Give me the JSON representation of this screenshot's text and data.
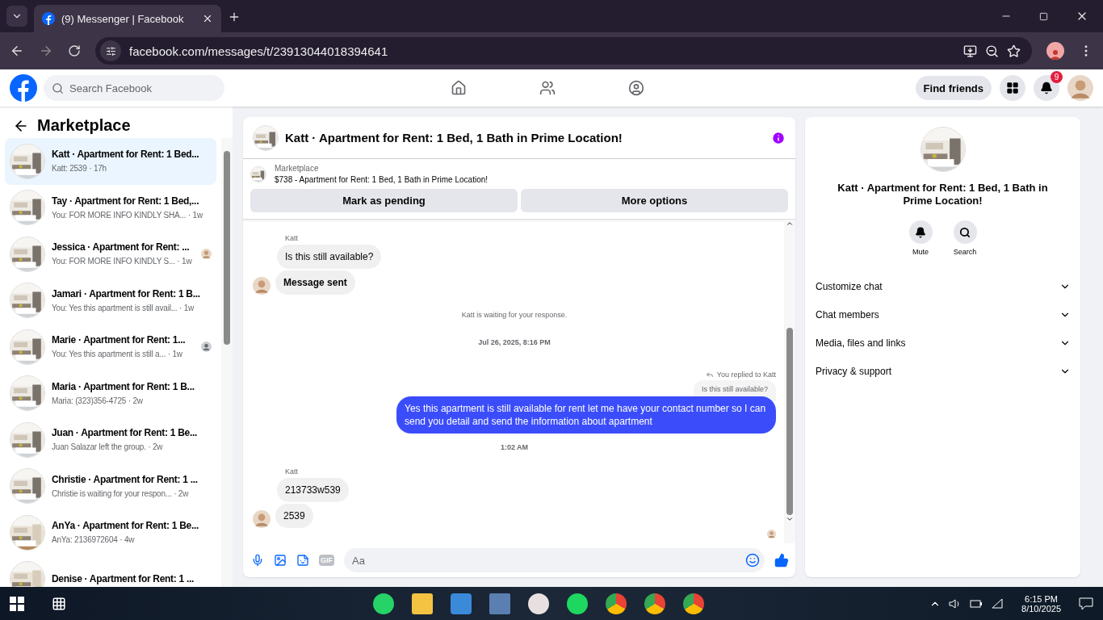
{
  "browser": {
    "tab_title": "(9) Messenger | Facebook",
    "url": "facebook.com/messages/t/23913044018394641"
  },
  "topbar": {
    "search_placeholder": "Search Facebook",
    "find_friends": "Find friends",
    "notification_count": "9"
  },
  "sidebar": {
    "title": "Marketplace",
    "conversations": [
      {
        "name": "Katt · Apartment for Rent: 1 Bed...",
        "preview": "Katt: 2539 · 17h",
        "selected": true,
        "kind": "plain"
      },
      {
        "name": "Tay · Apartment for Rent: 1 Bed,...",
        "preview": "You: FOR MORE INFO KINDLY SHA... · 1w",
        "selected": false,
        "kind": "plain"
      },
      {
        "name": "Jessica · Apartment for Rent: ...",
        "preview": "You: FOR MORE INFO KINDLY S... · 1w",
        "selected": false,
        "kind": "seen_photo"
      },
      {
        "name": "Jamari · Apartment for Rent: 1 B...",
        "preview": "You: Yes this apartment is still avail... · 1w",
        "selected": false,
        "kind": "plain"
      },
      {
        "name": "Marie · Apartment for Rent: 1...",
        "preview": "You: Yes this apartment is still a... · 1w",
        "selected": false,
        "kind": "seen_default"
      },
      {
        "name": "Maria · Apartment for Rent: 1 B...",
        "preview": "Maria: (323)356-4725 · 2w",
        "selected": false,
        "kind": "plain"
      },
      {
        "name": "Juan · Apartment for Rent: 1 Be...",
        "preview": "Juan Salazar left the group. · 2w",
        "selected": false,
        "kind": "plain"
      },
      {
        "name": "Christie · Apartment for Rent: 1 ...",
        "preview": "Christie is waiting for your respon... · 2w",
        "selected": false,
        "kind": "plain"
      },
      {
        "name": "AnYa · Apartment for Rent: 1 Be...",
        "preview": "AnYa: 2136972604 · 4w",
        "selected": false,
        "kind": "plain"
      },
      {
        "name": "Denise · Apartment for Rent: 1 ...",
        "selected": false,
        "kind": "plain"
      }
    ]
  },
  "chat": {
    "title": "Katt · Apartment for Rent: 1 Bed, 1 Bath in Prime Location!",
    "listing": {
      "label": "Marketplace",
      "text": "$738 - Apartment for Rent: 1 Bed, 1 Bath in Prime Location!"
    },
    "actions": [
      "Mark as pending",
      "More options"
    ],
    "messages": [
      {
        "kind": "sender",
        "text": "Katt"
      },
      {
        "kind": "incoming",
        "text": "Is this still available?",
        "avatar": false,
        "bold": false
      },
      {
        "kind": "incoming",
        "text": "Message sent",
        "avatar": true,
        "bold": true
      },
      {
        "kind": "system",
        "text": "Katt is waiting for your response."
      },
      {
        "kind": "timestamp",
        "text": "Jul 26, 2025, 8:16 PM"
      },
      {
        "kind": "reply_label",
        "text": "You replied to Katt"
      },
      {
        "kind": "quote",
        "text": "Is this still available?"
      },
      {
        "kind": "outgoing",
        "text": "Yes this apartment is still available for rent let me have your contact number so I can send you detail and send the information about apartment"
      },
      {
        "kind": "timestamp",
        "text": "1:02 AM"
      },
      {
        "kind": "sender",
        "text": "Katt"
      },
      {
        "kind": "incoming",
        "text": "213733w539",
        "avatar": false,
        "bold": false
      },
      {
        "kind": "incoming",
        "text": "2539",
        "avatar": true,
        "bold": false
      },
      {
        "kind": "seen"
      }
    ],
    "gif_label": "GIF",
    "composer_placeholder": "Aa"
  },
  "details": {
    "title": "Katt · Apartment for Rent: 1 Bed, 1 Bath in Prime Location!",
    "buttons": [
      {
        "kind": "mute",
        "label": "Mute"
      },
      {
        "kind": "search",
        "label": "Search"
      }
    ],
    "sections": [
      {
        "label": "Customize chat",
        "expanded": false
      },
      {
        "label": "Chat members",
        "expanded": false
      },
      {
        "label": "Media, files and links",
        "expanded": false
      },
      {
        "label": "Privacy & support",
        "expanded": false
      }
    ]
  },
  "taskbar": {
    "time": "6:15 PM",
    "date": "8/10/2025"
  }
}
